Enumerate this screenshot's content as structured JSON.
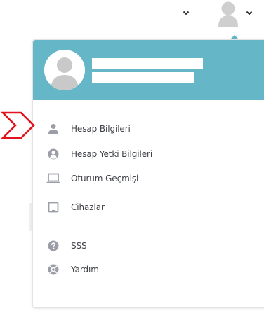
{
  "topbar": {
    "caret_icon": "chevron-down-icon",
    "avatar_icon": "user-avatar-icon"
  },
  "menu": {
    "items": [
      {
        "label": "Hesap Bilgileri",
        "icon": "user-icon"
      },
      {
        "label": "Hesap Yetki Bilgileri",
        "icon": "user-circle-icon"
      },
      {
        "label": "Oturum Geçmişi",
        "icon": "laptop-icon"
      },
      {
        "label": "Cihazlar",
        "icon": "tablet-icon"
      },
      {
        "label": "SSS",
        "icon": "question-circle-icon"
      },
      {
        "label": "Yardım",
        "icon": "lifebuoy-icon"
      }
    ]
  },
  "colors": {
    "header": "#65b6c6",
    "icon": "#9b9ea6",
    "highlight_arrow": "#e1131c"
  }
}
